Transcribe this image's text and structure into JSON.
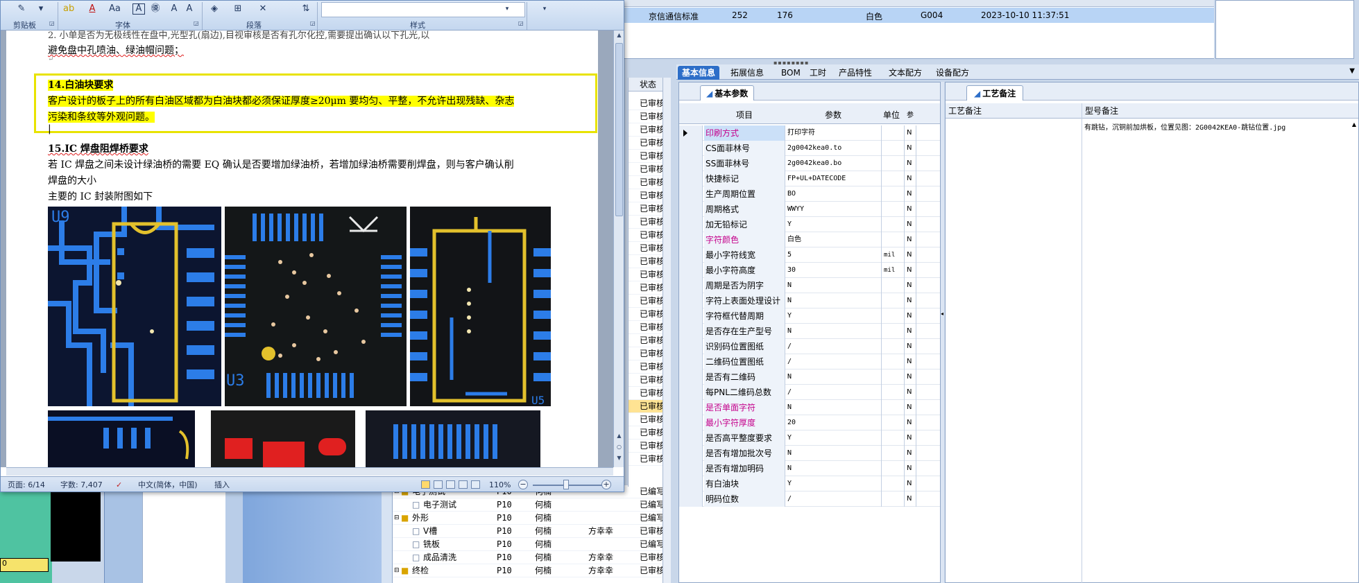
{
  "word": {
    "ribbon": {
      "groups": [
        "剪贴板",
        "字体",
        "段落",
        "样式"
      ]
    },
    "document": {
      "intro_line1": "2. 小单是否为无极线性在盘中,光型孔(扇边),目视审核是否有孔尔化控,需要提出确认以下孔光,以",
      "intro_line2": "避免盘中孔喷油、绿油帽问题；",
      "section14_title": "14.白油块要求",
      "section14_body1": "客户设计的板子上的所有白油区域都为白油块都必须保证厚度≥20μm 要均匀、平整，不允许出现残缺、杂志",
      "section14_body2": "污染和条纹等外观问题。",
      "section15_title": "15.IC 焊盘阻焊桥要求",
      "section15_body1": "若 IC 焊盘之间未设计绿油桥的需要 EQ 确认是否要增加绿油桥，若增加绿油桥需要削焊盘，则与客户确认削",
      "section15_body2": "焊盘的大小",
      "section15_body3": "主要的 IC 封装附图如下",
      "pcb_labels": {
        "u9": "U9",
        "u3": "U3",
        "u5": "U5"
      }
    },
    "status_bar": {
      "page": "页面: 6/14",
      "words": "字数: 7,407",
      "language": "中文(简体，中国)",
      "mode": "插入",
      "zoom": "110%"
    }
  },
  "top_grid": {
    "row": {
      "standard": "京信通信标准",
      "v1": "252",
      "v2": "176",
      "color": "白色",
      "code": "G004",
      "datetime": "2023-10-10 11:37:51"
    }
  },
  "status_column": {
    "header": "状态",
    "cells": [
      "已审核",
      "已审核",
      "已审核",
      "已审核",
      "已审核",
      "已审核",
      "已审核",
      "已审核",
      "已审核",
      "已审核",
      "已审核",
      "已审核",
      "已审核",
      "已审核",
      "已审核",
      "已审核",
      "已审核",
      "已审核",
      "已审核",
      "已审核",
      "已审核",
      "已审核",
      "已审核",
      "已审核",
      "已审核",
      "已审核",
      "已审核",
      "已审核"
    ]
  },
  "tree": {
    "rows": [
      {
        "indent": 0,
        "icon": "folder",
        "name": "电子测试",
        "code": "P10",
        "person": "何楠",
        "person2": "",
        "status": "已编写"
      },
      {
        "indent": 1,
        "icon": "file",
        "name": "电子测试",
        "code": "P10",
        "person": "何楠",
        "person2": "",
        "status": "已编写"
      },
      {
        "indent": 0,
        "icon": "folder",
        "name": "外形",
        "code": "P10",
        "person": "何楠",
        "person2": "",
        "status": "已编写"
      },
      {
        "indent": 1,
        "icon": "file",
        "name": "V槽",
        "code": "P10",
        "person": "何楠",
        "person2": "方幸幸",
        "status": "已审核"
      },
      {
        "indent": 1,
        "icon": "file",
        "name": "铣板",
        "code": "P10",
        "person": "何楠",
        "person2": "",
        "status": "已编写"
      },
      {
        "indent": 1,
        "icon": "file",
        "name": "成品清洗",
        "code": "P10",
        "person": "何楠",
        "person2": "方幸幸",
        "status": "已审核"
      },
      {
        "indent": 0,
        "icon": "folder",
        "name": "终检",
        "code": "P10",
        "person": "何楠",
        "person2": "方幸幸",
        "status": "已审核"
      }
    ]
  },
  "tabs": [
    "基本信息",
    "拓展信息",
    "BOM",
    "工时",
    "产品特性",
    "文本配方",
    "设备配方"
  ],
  "basic_params": {
    "title": "基本参数",
    "headers": {
      "item": "项目",
      "param": "参数",
      "unit": "单位",
      "extra": "参"
    },
    "rows": [
      {
        "item": "印刷方式",
        "param": "打印字符",
        "unit": "",
        "flag": "N",
        "pink": true
      },
      {
        "item": "CS面菲林号",
        "param": "2g0042kea0.to",
        "unit": "",
        "flag": "N",
        "pink": false
      },
      {
        "item": "SS面菲林号",
        "param": "2g0042kea0.bo",
        "unit": "",
        "flag": "N",
        "pink": false
      },
      {
        "item": "快捷标记",
        "param": "FP+UL+DATECODE",
        "unit": "",
        "flag": "N",
        "pink": false
      },
      {
        "item": "生产周期位置",
        "param": "BO",
        "unit": "",
        "flag": "N",
        "pink": false
      },
      {
        "item": "周期格式",
        "param": "WWYY",
        "unit": "",
        "flag": "N",
        "pink": false
      },
      {
        "item": "加无铅标记",
        "param": "Y",
        "unit": "",
        "flag": "N",
        "pink": false
      },
      {
        "item": "字符颜色",
        "param": "白色",
        "unit": "",
        "flag": "N",
        "pink": true
      },
      {
        "item": "最小字符线宽",
        "param": "5",
        "unit": "mil",
        "flag": "N",
        "pink": false
      },
      {
        "item": "最小字符高度",
        "param": "30",
        "unit": "mil",
        "flag": "N",
        "pink": false
      },
      {
        "item": "周期是否为阴字",
        "param": "N",
        "unit": "",
        "flag": "N",
        "pink": false
      },
      {
        "item": "字符上表面处理设计",
        "param": "N",
        "unit": "",
        "flag": "N",
        "pink": false
      },
      {
        "item": "字符框代替周期",
        "param": "Y",
        "unit": "",
        "flag": "N",
        "pink": false
      },
      {
        "item": "是否存在生产型号",
        "param": "N",
        "unit": "",
        "flag": "N",
        "pink": false
      },
      {
        "item": "识别码位置图纸",
        "param": "/",
        "unit": "",
        "flag": "N",
        "pink": false
      },
      {
        "item": "二维码位置图纸",
        "param": "/",
        "unit": "",
        "flag": "N",
        "pink": false
      },
      {
        "item": "是否有二维码",
        "param": "N",
        "unit": "",
        "flag": "N",
        "pink": false
      },
      {
        "item": "每PNL二维码总数",
        "param": "/",
        "unit": "",
        "flag": "N",
        "pink": false
      },
      {
        "item": "是否单面字符",
        "param": "N",
        "unit": "",
        "flag": "N",
        "pink": true
      },
      {
        "item": "最小字符厚度",
        "param": "20",
        "unit": "",
        "flag": "N",
        "pink": true
      },
      {
        "item": "是否高平整度要求",
        "param": "Y",
        "unit": "",
        "flag": "N",
        "pink": false
      },
      {
        "item": "是否有增加批次号",
        "param": "N",
        "unit": "",
        "flag": "N",
        "pink": false
      },
      {
        "item": "是否有增加明码",
        "param": "N",
        "unit": "",
        "flag": "N",
        "pink": false
      },
      {
        "item": "有白油块",
        "param": "Y",
        "unit": "",
        "flag": "N",
        "pink": false
      },
      {
        "item": "明码位数",
        "param": "/",
        "unit": "",
        "flag": "N",
        "pink": false
      }
    ]
  },
  "process_notes": {
    "title": "工艺备注",
    "col1": "工艺备注",
    "col2": "型号备注",
    "note": "有跳钻，沉铜前加烘板，位置见图：2G0042KEA0-跳钻位置.jpg"
  },
  "bg": {
    "yellow_cell": "0"
  },
  "colors": {
    "accent": "#2d6ec8",
    "highlight": "#ffff00",
    "pink_label": "#c4008b",
    "selection": "#b8d4f5"
  }
}
